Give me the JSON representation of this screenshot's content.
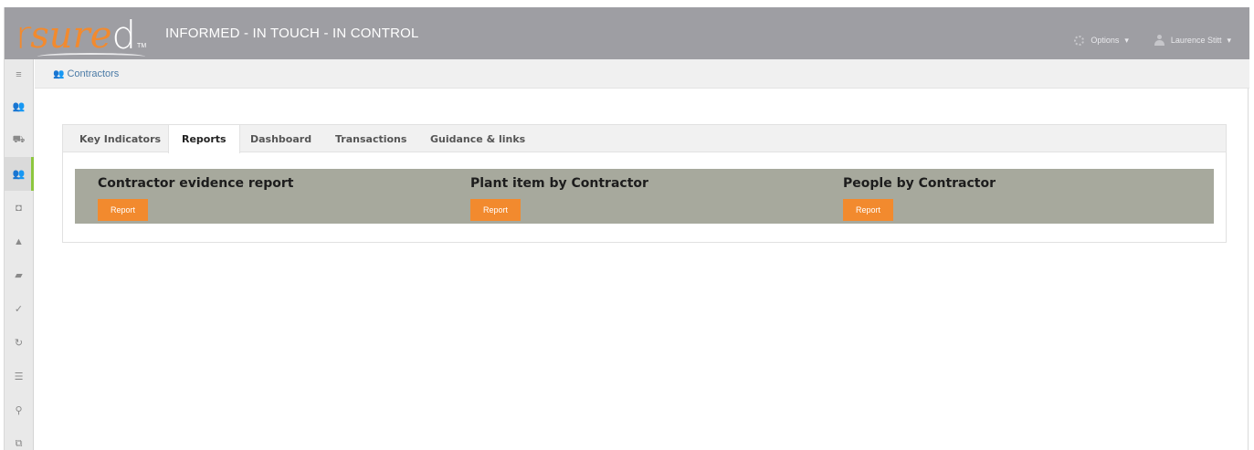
{
  "header": {
    "logo": {
      "r": "r",
      "sure": "sure",
      "d": "d",
      "tm": "TM"
    },
    "tagline": "INFORMED - IN TOUCH - IN CONTROL",
    "options_label": "Options",
    "user_label": "Laurence Stitt",
    "dropdown_caret": "▾"
  },
  "sidebar": {
    "items": [
      {
        "icon": "menu-icon",
        "glyph": "≡"
      },
      {
        "icon": "users-icon",
        "glyph": "👥"
      },
      {
        "icon": "vehicle-icon",
        "glyph": "⛟"
      },
      {
        "icon": "contractors-icon",
        "glyph": "👥",
        "active": true
      },
      {
        "icon": "camera-icon",
        "glyph": "◘"
      },
      {
        "icon": "warning-icon",
        "glyph": "▲"
      },
      {
        "icon": "book-icon",
        "glyph": "▰"
      },
      {
        "icon": "check-icon",
        "glyph": "✓"
      },
      {
        "icon": "refresh-icon",
        "glyph": "↻"
      },
      {
        "icon": "list-icon",
        "glyph": "☰"
      },
      {
        "icon": "map-marker-icon",
        "glyph": "⚲"
      },
      {
        "icon": "documents-icon",
        "glyph": "⧉"
      }
    ]
  },
  "breadcrumb": {
    "icon": "👥",
    "label": "Contractors"
  },
  "tabs": [
    {
      "label": "Key Indicators"
    },
    {
      "label": "Reports",
      "active": true
    },
    {
      "label": "Dashboard"
    },
    {
      "label": "Transactions"
    },
    {
      "label": "Guidance & links"
    }
  ],
  "reports": [
    {
      "title": "Contractor evidence report",
      "button": "Report"
    },
    {
      "title": "Plant item by Contractor",
      "button": "Report"
    },
    {
      "title": "People by Contractor",
      "button": "Report"
    }
  ],
  "colors": {
    "accent": "#f28a2e",
    "header": "#9e9ea3",
    "report_band": "#a7a99d",
    "active_marker": "#8dc63f",
    "link": "#4a7aa6"
  }
}
